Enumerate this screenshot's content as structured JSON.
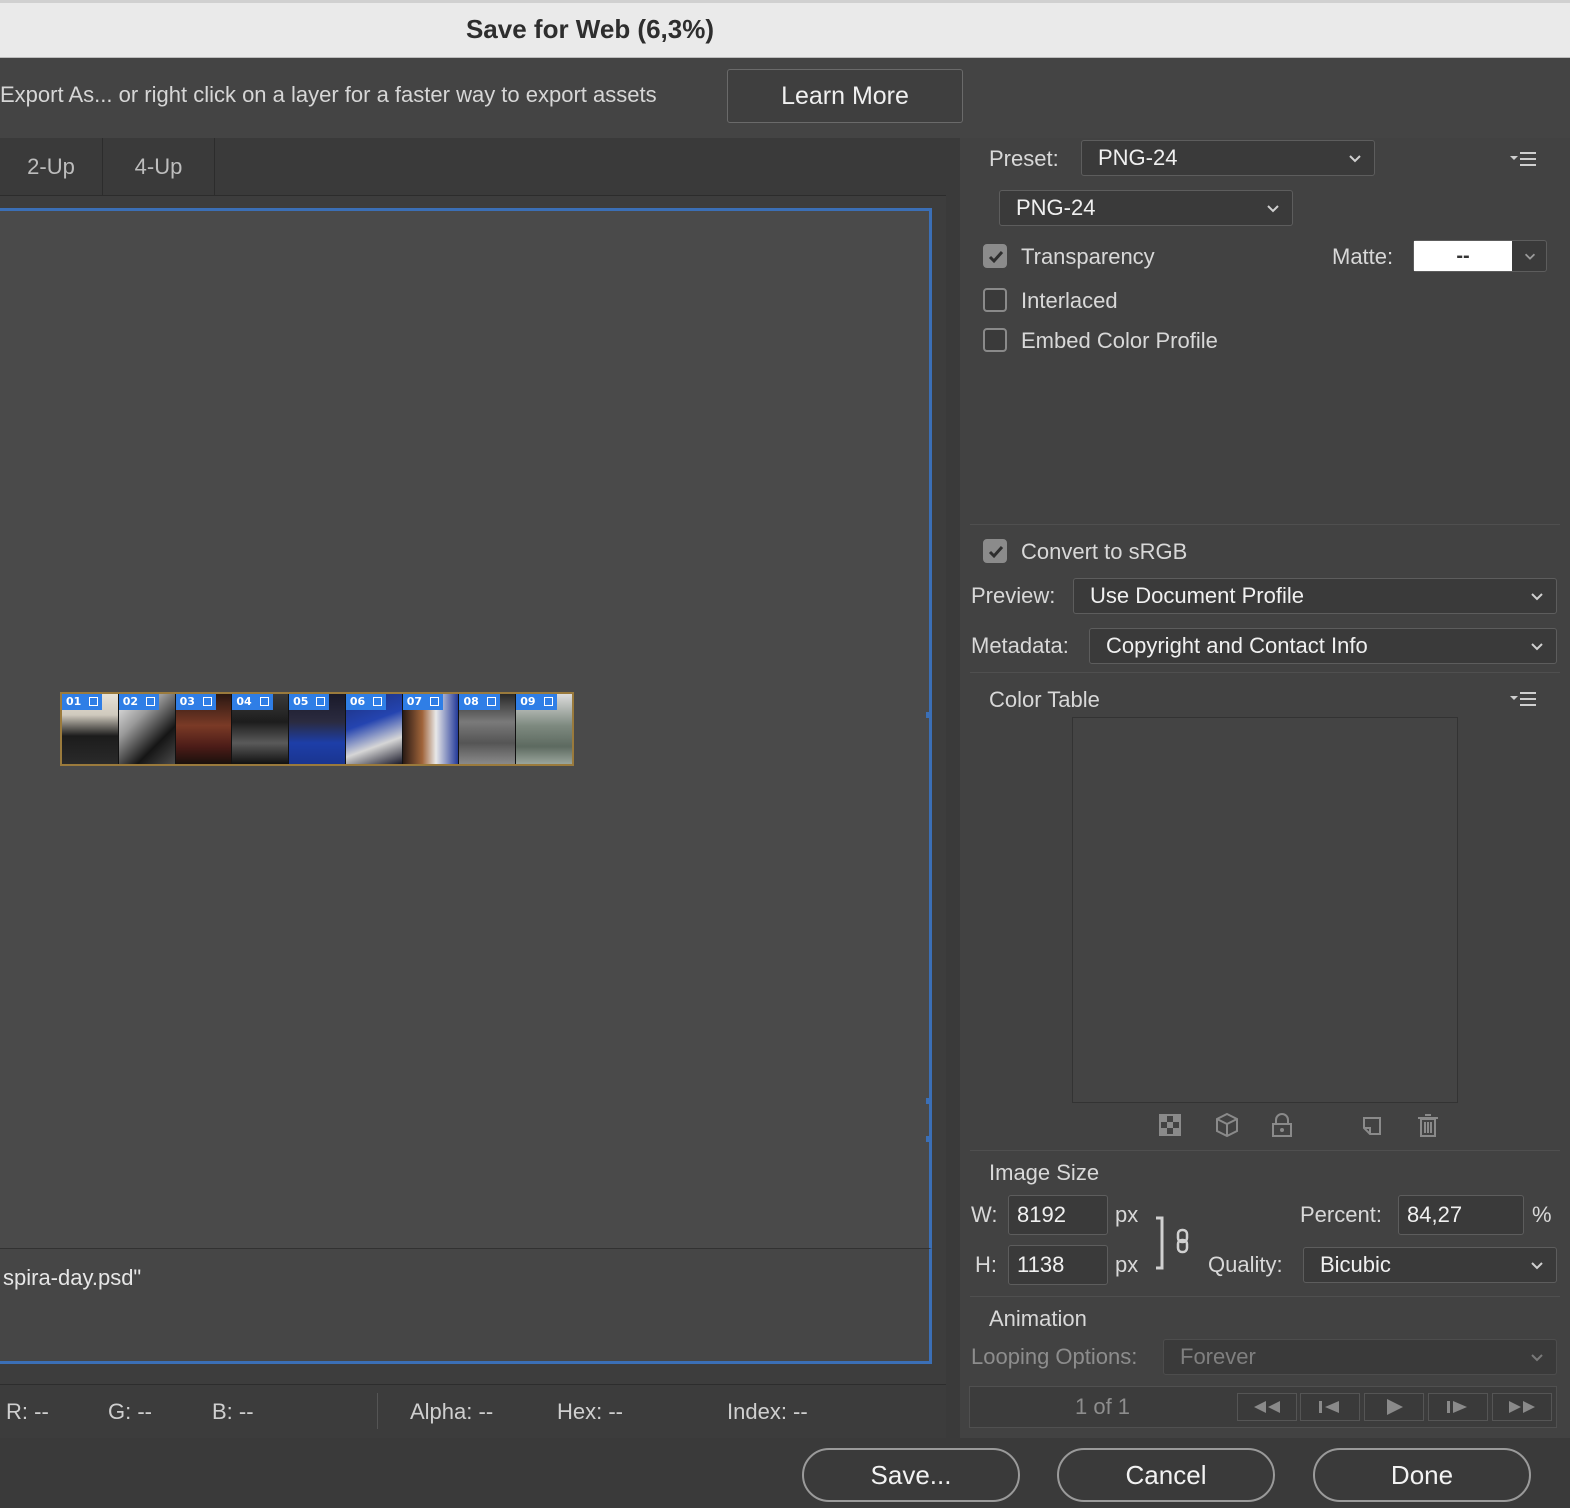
{
  "window": {
    "title": "Save for Web (6,3%)"
  },
  "info_bar": {
    "message": "Export As... or right click on a layer for a faster way to export assets",
    "learn_more": "Learn More"
  },
  "view_tabs": [
    "2-Up",
    "4-Up"
  ],
  "canvas": {
    "file_label": "spira-day.psd\"",
    "slices": [
      "01",
      "02",
      "03",
      "04",
      "05",
      "06",
      "07",
      "08",
      "09"
    ],
    "icons": [
      "slice-icon"
    ]
  },
  "status_bar": {
    "r": "R: --",
    "g": "G: --",
    "b": "B: --",
    "alpha": "Alpha: --",
    "hex": "Hex: --",
    "index": "Index: --"
  },
  "settings": {
    "preset_label": "Preset:",
    "preset_value": "PNG-24",
    "format_value": "PNG-24",
    "transparency": {
      "label": "Transparency",
      "checked": true
    },
    "matte_label": "Matte:",
    "matte_value": "--",
    "interlaced": {
      "label": "Interlaced",
      "checked": false
    },
    "embed_profile": {
      "label": "Embed Color Profile",
      "checked": false
    },
    "convert_srgb": {
      "label": "Convert to sRGB",
      "checked": true
    },
    "preview_label": "Preview:",
    "preview_value": "Use Document Profile",
    "metadata_label": "Metadata:",
    "metadata_value": "Copyright and Contact Info"
  },
  "color_table": {
    "title": "Color Table",
    "tool_icons": [
      "map-transparency-icon",
      "web-shift-icon",
      "lock-color-icon",
      "new-color-icon",
      "trash-icon"
    ]
  },
  "image_size": {
    "title": "Image Size",
    "w_label": "W:",
    "w_value": "8192",
    "w_unit": "px",
    "h_label": "H:",
    "h_value": "1138",
    "h_unit": "px",
    "percent_label": "Percent:",
    "percent_value": "84,27",
    "percent_unit": "%",
    "quality_label": "Quality:",
    "quality_value": "Bicubic"
  },
  "animation": {
    "title": "Animation",
    "looping_label": "Looping Options:",
    "looping_value": "Forever",
    "frame_counter": "1 of 1",
    "controls": [
      "first-frame-icon",
      "previous-frame-icon",
      "play-icon",
      "next-frame-icon",
      "last-frame-icon"
    ]
  },
  "buttons": {
    "save": "Save...",
    "cancel": "Cancel",
    "done": "Done"
  },
  "colors": {
    "accent_blue": "#3b6fb6",
    "slice_tag": "#2f7ee6",
    "panel": "#424242"
  }
}
